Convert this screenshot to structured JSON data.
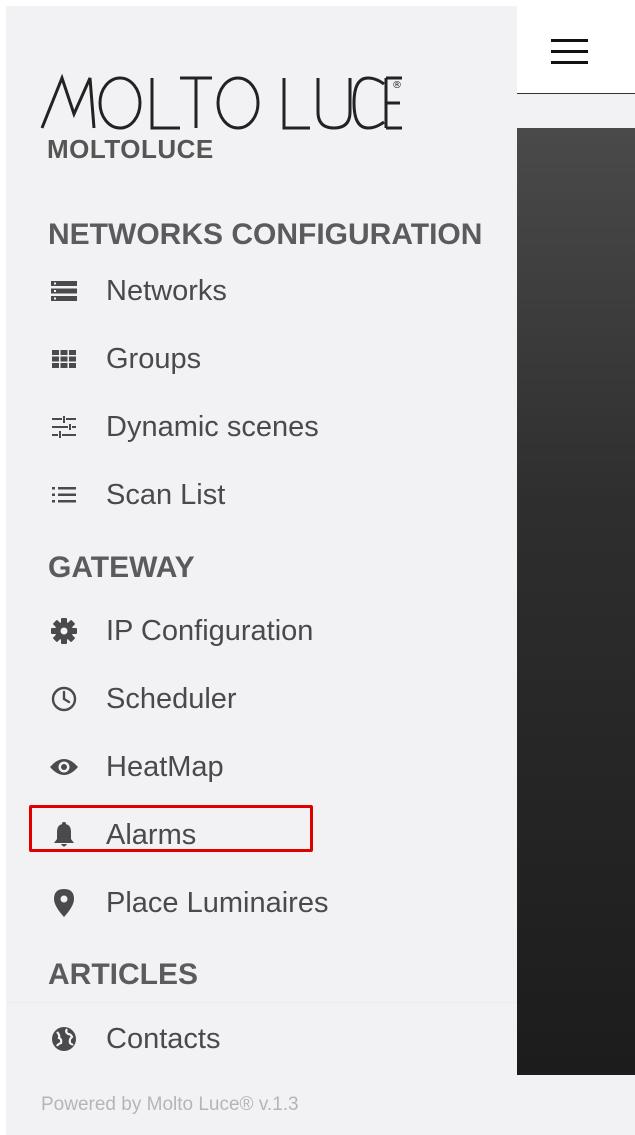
{
  "brand": {
    "logo_text": "MOLTO LUCE®",
    "subtitle": "MOLTOLUCE"
  },
  "sections": {
    "networks": "NETWORKS CONFIGURATION",
    "gateway": "GATEWAY",
    "articles": "ARTICLES"
  },
  "menu": {
    "networks": {
      "label": "Networks",
      "icon": "list-icon"
    },
    "groups": {
      "label": "Groups",
      "icon": "grid-icon"
    },
    "dynamic_scenes": {
      "label": "Dynamic scenes",
      "icon": "sliders-icon"
    },
    "scan_list": {
      "label": "Scan List",
      "icon": "bullet-list-icon"
    },
    "ip_configuration": {
      "label": "IP Configuration",
      "icon": "gear-icon"
    },
    "scheduler": {
      "label": "Scheduler",
      "icon": "clock-icon"
    },
    "heatmap": {
      "label": "HeatMap",
      "icon": "eye-icon"
    },
    "alarms": {
      "label": "Alarms",
      "icon": "bell-icon"
    },
    "place_luminaires": {
      "label": "Place Luminaires",
      "icon": "map-pin-icon"
    },
    "contacts": {
      "label": "Contacts",
      "icon": "globe-icon"
    }
  },
  "footer": {
    "text": "Powered by Molto Luce® v.1.3"
  },
  "colors": {
    "highlight": "#e00000",
    "sidebar_bg": "#f2f2f4",
    "text": "#4a4a4d"
  }
}
